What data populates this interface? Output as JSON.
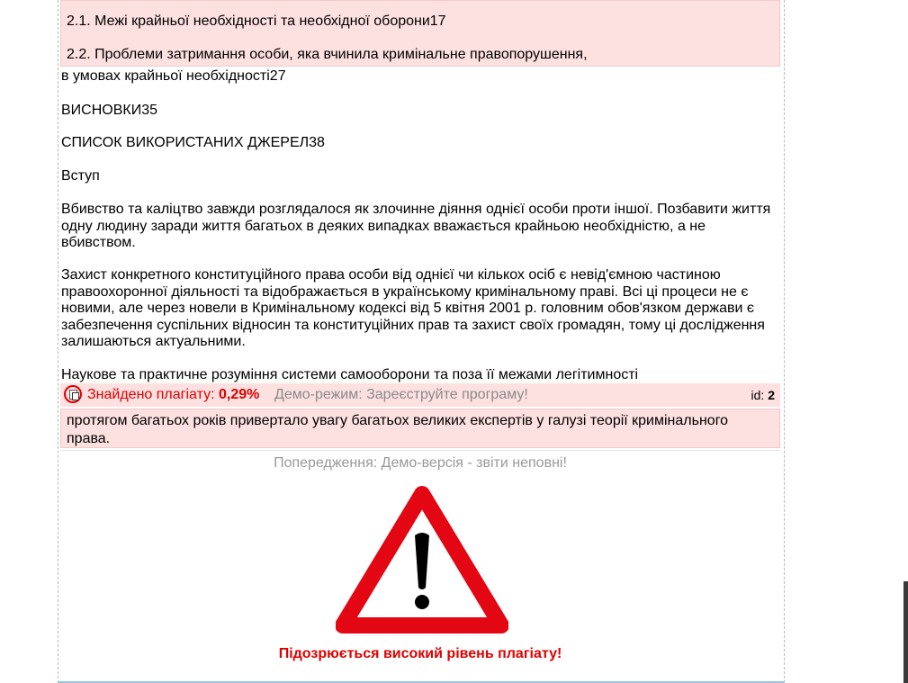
{
  "toc": {
    "item_2_1": "2.1. Межі крайньої необхідності та необхідної оборони17",
    "item_2_2": "2.2. Проблеми затримання особи, яка вчинила кримінальне правопорушення,",
    "item_2_2_cont": "в умовах крайньої необхідності27",
    "conclusions": "ВИСНОВКИ35",
    "sources": "СПИСОК ВИКОРИСТАНИХ ДЖЕРЕЛ38"
  },
  "intro": {
    "heading": "Вступ",
    "para1": "Вбивство та каліцтво завжди розглядалося як злочинне діяння однієї особи проти іншої. Позбавити життя одну людину заради життя багатьох в деяких випадках вважається крайньою необхідністю, а не вбивством.",
    "para2": "Захист конкретного конституційного права особи від однієї чи кількох осіб є невід'ємною частиною правоохоронної діяльності та відображається в українському кримінальному праві. Всі ці процеси не є новими, але через новели в Кримінальному кодексі від 5 квітня 2001 р. головним обов'язком держави є забезпечення суспільних відносин та конституційних прав та захист своїх громадян, тому ці дослідження залишаються актуальними.",
    "para3": "Наукове та практичне розуміння системи самооборони та поза її межами легітимності"
  },
  "plagiarism": {
    "found_label": "Знайдено плагіату: ",
    "found_percent": "0,29%",
    "demo_notice": "Демо-режим: Зареєструйте програму!",
    "id_label": "id: ",
    "id_value": "2",
    "quote": "протягом багатьох років привертало увагу багатьох великих експертів у галузі теорії кримінального права."
  },
  "warning": {
    "title": "Попередження: Демо-версія - звіти неповні!",
    "message": "Підозрюється високий рівень плагіату!",
    "icon": "warning-triangle-icon",
    "colors": {
      "triangle": "#e30613",
      "alert_text": "#e00000",
      "highlight_bg": "#fde0e0"
    }
  }
}
